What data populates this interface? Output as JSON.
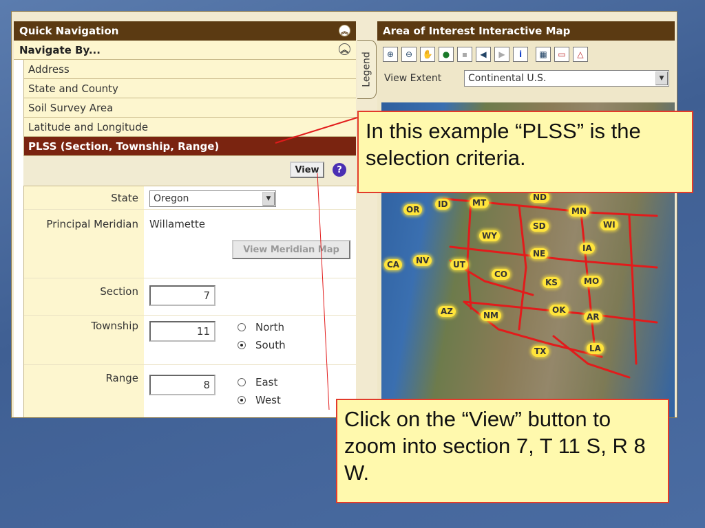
{
  "quick_nav": {
    "title": "Quick Navigation",
    "navigate_by": "Navigate By...",
    "items": [
      {
        "label": "Address"
      },
      {
        "label": "State and County"
      },
      {
        "label": "Soil Survey Area"
      },
      {
        "label": "Latitude and Longitude"
      },
      {
        "label": "PLSS (Section, Township, Range)",
        "active": true
      }
    ],
    "view_label": "View",
    "help": "?"
  },
  "form": {
    "state_label": "State",
    "state_value": "Oregon",
    "meridian_label": "Principal Meridian",
    "meridian_value": "Willamette",
    "meridian_map_label": "View Meridian Map",
    "section_label": "Section",
    "section_value": "7",
    "township_label": "Township",
    "township_value": "11",
    "north_label": "North",
    "south_label": "South",
    "township_dir": "South",
    "range_label": "Range",
    "range_value": "8",
    "east_label": "East",
    "west_label": "West",
    "range_dir": "West"
  },
  "map_panel": {
    "title": "Area of Interest Interactive Map",
    "legend_tab": "Legend",
    "view_extent_label": "View Extent",
    "view_extent_value": "Continental U.S.",
    "tools": [
      "zoom-in-icon",
      "zoom-out-icon",
      "pan-hand-icon",
      "globe-icon",
      "aoi-icon",
      "back-arrow-icon",
      "forward-arrow-icon",
      "info-icon",
      "layers-icon",
      "aoi-define-icon",
      "aoi-clear-icon"
    ],
    "states": [
      "MT",
      "ND",
      "OR",
      "ID",
      "MN",
      "SD",
      "WY",
      "WI",
      "NE",
      "IA",
      "CA",
      "NV",
      "UT",
      "CO",
      "KS",
      "MO",
      "AZ",
      "NM",
      "OK",
      "AR",
      "TX",
      "LA"
    ]
  },
  "callouts": {
    "top": "In this example “PLSS” is the selection criteria.",
    "bottom": "Click on the “View” button to zoom into section 7, T 11 S, R 8 W."
  },
  "colors": {
    "header": "#5b3a12",
    "active_item": "#7a2410",
    "callout_bg": "#fff9ad",
    "callout_border": "#e23b2a"
  }
}
